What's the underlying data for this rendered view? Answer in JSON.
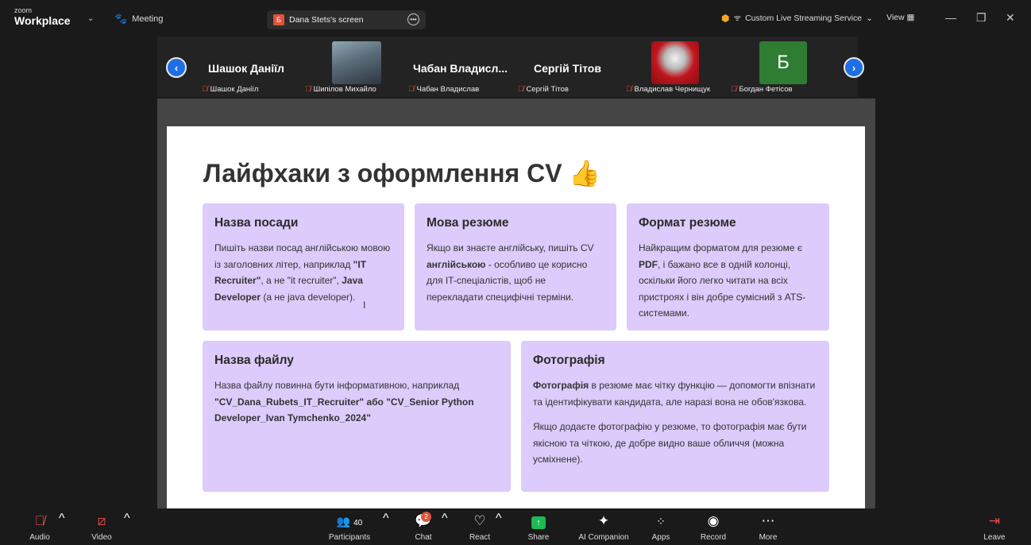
{
  "app": {
    "logo_small": "zoom",
    "logo_big": "Workplace",
    "meeting_label": "Meeting"
  },
  "screen_share": {
    "badge": "Б",
    "label": "Dana Stets's screen"
  },
  "streaming": {
    "label": "Custom Live Streaming Service",
    "view_label": "View"
  },
  "participants_strip": [
    {
      "display": "Шашок Даніїл",
      "label": "Шашок Даніїл",
      "has_photo": false
    },
    {
      "display": "",
      "label": "Шипілов Михайло",
      "has_photo": true,
      "photo": "person-photo"
    },
    {
      "display": "Чабан Владисл...",
      "label": "Чабан Владислав",
      "has_photo": false
    },
    {
      "display": "Сергій Тітов",
      "label": "Сергій Тітов",
      "has_photo": false
    },
    {
      "display": "",
      "label": "Владислав Чернищук",
      "has_photo": true,
      "photo": "anime-avatar"
    },
    {
      "display": "Б",
      "label": "Богдан Фетісов",
      "has_photo": false,
      "avatar_letter": "Б",
      "avatar_color": "#2e7d32"
    }
  ],
  "slide": {
    "title": "Лайфхаки з оформлення CV 👍",
    "card_color": "#dccbfb",
    "cards": [
      {
        "heading": "Назва посади",
        "paragraphs": [
          [
            {
              "t": "Пишіть назви посад англійською мовою із заголовних літер, наприклад "
            },
            {
              "t": "\"IT Recruiter\"",
              "b": true
            },
            {
              "t": ", а не \"it recruiter\", "
            },
            {
              "t": "Java Developer",
              "b": true
            },
            {
              "t": " (а не java developer)."
            }
          ]
        ]
      },
      {
        "heading": "Мова резюме",
        "paragraphs": [
          [
            {
              "t": "Якщо ви знаєте англійську, пишіть CV "
            },
            {
              "t": "англійською",
              "b": true
            },
            {
              "t": " - особливо це корисно для IT-спеціалістів, щоб не перекладати специфічні терміни."
            }
          ]
        ]
      },
      {
        "heading": "Формат резюме",
        "paragraphs": [
          [
            {
              "t": "Найкращим форматом для резюме є "
            },
            {
              "t": "PDF",
              "b": true
            },
            {
              "t": ", і бажано все в одній колонці, оскільки його легко читати на всіх пристроях і він добре сумісний з ATS-системами."
            }
          ]
        ]
      },
      {
        "heading": "Назва файлу",
        "paragraphs": [
          [
            {
              "t": "Назва файлу повинна бути інформативною, наприклад "
            },
            {
              "t": "\"CV_Dana_Rubets_IT_Recruiter\" або \"CV_Senior Python Developer_Ivan Tymchenko_2024\"",
              "b": true
            }
          ]
        ]
      },
      {
        "heading": "Фотографія",
        "paragraphs": [
          [
            {
              "t": "Фотографія",
              "b": true
            },
            {
              "t": " в резюме має чітку функцію — допомогти впізнати та ідентифікувати кандидата, але наразі вона не обов'язкова."
            }
          ],
          [
            {
              "t": "Якщо додаєте фотографію у резюме, то фотографія має бути якісною та чіткою, де добре видно ваше обличчя (можна усміхнене)."
            }
          ]
        ]
      }
    ]
  },
  "toolbar": {
    "audio": "Audio",
    "video": "Video",
    "participants": "Participants",
    "participants_count": "40",
    "chat": "Chat",
    "chat_badge": "2",
    "react": "React",
    "share": "Share",
    "ai": "AI Companion",
    "apps": "Apps",
    "record": "Record",
    "more": "More",
    "leave": "Leave"
  }
}
